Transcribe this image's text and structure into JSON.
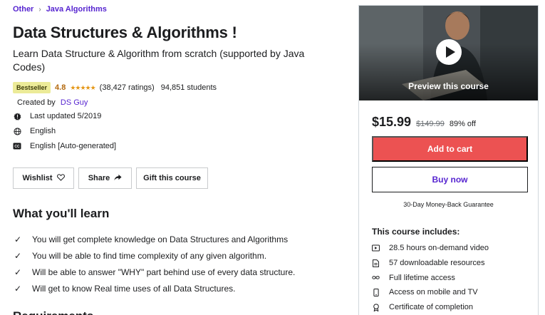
{
  "breadcrumb": {
    "items": [
      "Other",
      "Java Algorithms"
    ],
    "separator": "›"
  },
  "course": {
    "title": "Data Structures & Algorithms !",
    "subtitle": "Learn Data Structure & Algorithm from scratch (supported by Java Codes)",
    "badge": "Bestseller",
    "rating": "4.8",
    "stars": "★★★★★",
    "ratings_count": "(38,427 ratings)",
    "students": "94,851 students",
    "created_by_label": "Created by",
    "author": "DS Guy",
    "last_updated": "Last updated 5/2019",
    "language": "English",
    "captions": "English [Auto-generated]"
  },
  "actions": {
    "wishlist": "Wishlist",
    "share": "Share",
    "gift": "Gift this course"
  },
  "learn": {
    "title": "What you'll learn",
    "items": [
      "You will get complete knowledge on Data Structures and Algorithms",
      "You will be able to find time complexity of any given algorithm.",
      "Will be able to answer \"WHY\" part behind use of every data structure.",
      "Will get to know Real time uses of all Data Structures."
    ]
  },
  "requirements": {
    "title": "Requirements"
  },
  "sidebar": {
    "preview_label": "Preview this course",
    "price": "$15.99",
    "original_price": "$149.99",
    "discount": "89% off",
    "add_to_cart": "Add to cart",
    "buy_now": "Buy now",
    "guarantee": "30-Day Money-Back Guarantee",
    "includes_title": "This course includes:",
    "includes": [
      {
        "icon": "video-icon",
        "text": "28.5 hours on-demand video"
      },
      {
        "icon": "file-icon",
        "text": "57 downloadable resources"
      },
      {
        "icon": "infinity-icon",
        "text": "Full lifetime access"
      },
      {
        "icon": "mobile-icon",
        "text": "Access on mobile and TV"
      },
      {
        "icon": "certificate-icon",
        "text": "Certificate of completion"
      }
    ]
  },
  "colors": {
    "accent": "#5624d0",
    "cart": "#ec5252",
    "rating": "#b4690e",
    "star": "#e59819",
    "badge_bg": "#eceb98"
  }
}
